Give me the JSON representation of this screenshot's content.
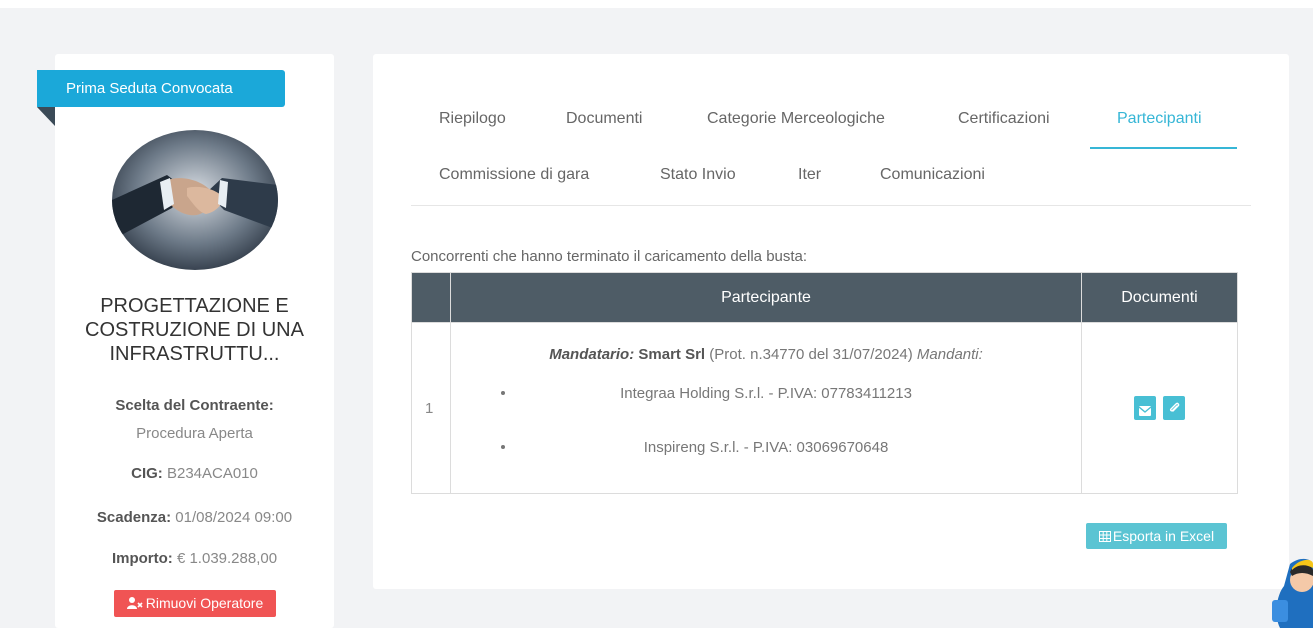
{
  "sidebar": {
    "status_ribbon": "Prima Seduta Convocata",
    "project_title": "PROGETTAZIONE E COSTRUZIONE DI UNA INFRASTRUTTU...",
    "scelta_label": "Scelta del Contraente:",
    "scelta_value": "Procedura Aperta",
    "cig_label": "CIG:",
    "cig_value": "B234ACA010",
    "scadenza_label": "Scadenza:",
    "scadenza_value": "01/08/2024 09:00",
    "importo_label": "Importo:",
    "importo_value": "€ 1.039.288,00",
    "remove_button": "Rimuovi Operatore"
  },
  "tabs": [
    {
      "label": "Riepilogo",
      "active": false
    },
    {
      "label": "Documenti",
      "active": false
    },
    {
      "label": "Categorie Merceologiche",
      "active": false
    },
    {
      "label": "Certificazioni",
      "active": false
    },
    {
      "label": "Partecipanti",
      "active": true
    },
    {
      "label": "Commissione di gara",
      "active": false
    },
    {
      "label": "Stato Invio",
      "active": false
    },
    {
      "label": "Iter",
      "active": false
    },
    {
      "label": "Comunicazioni",
      "active": false
    }
  ],
  "main": {
    "intro_text": "Concorrenti che hanno terminato il caricamento della busta:",
    "table": {
      "headers": [
        "",
        "Partecipante",
        "Documenti"
      ],
      "rows": [
        {
          "num": "1",
          "mandatario_label": "Mandatario:",
          "mandatario_name": "Smart Srl",
          "protocol": "(Prot. n.34770 del 31/07/2024)",
          "mandanti_label": "Mandanti:",
          "mandanti": [
            "Integraa Holding S.r.l. - P.IVA: 07783411213",
            "Inspireng S.r.l. - P.IVA: 03069670648"
          ]
        }
      ]
    },
    "export_button": "Esporta in Excel"
  },
  "icons": {
    "remove_operator": "user-times-icon",
    "email": "envelope-icon",
    "attachment": "paperclip-icon",
    "export": "table-icon"
  },
  "colors": {
    "accent": "#36b6d6",
    "ribbon": "#1ba8d9",
    "table_header": "#4e5c66",
    "danger": "#f05454",
    "doc_button": "#48bfd4"
  }
}
